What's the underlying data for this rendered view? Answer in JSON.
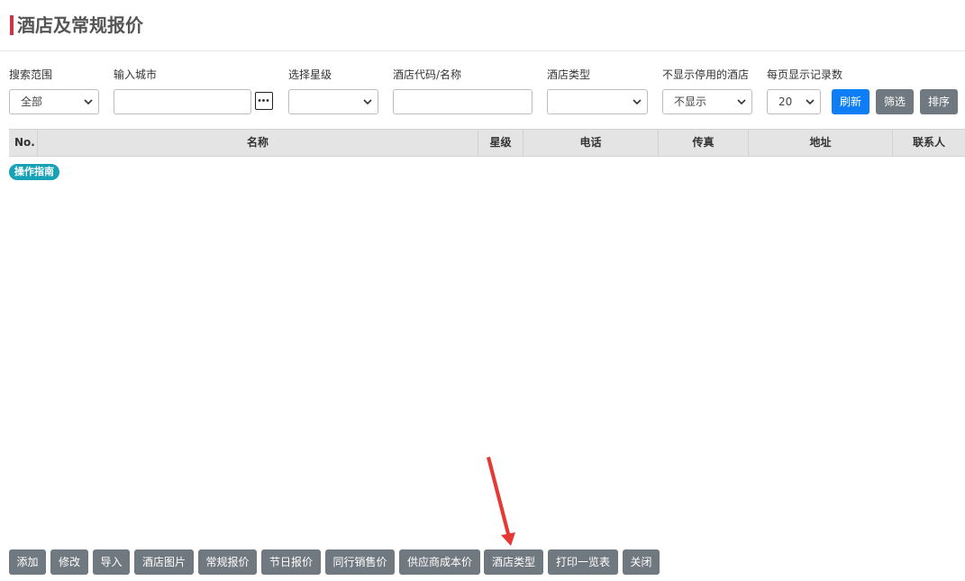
{
  "page": {
    "title": "酒店及常规报价",
    "accent_color": "#d9323f"
  },
  "filters": {
    "scope": {
      "label": "搜索范围",
      "value": "全部"
    },
    "city": {
      "label": "输入城市",
      "value": ""
    },
    "star": {
      "label": "选择星级",
      "value": ""
    },
    "code_name": {
      "label": "酒店代码/名称",
      "value": ""
    },
    "hotel_type": {
      "label": "酒店类型",
      "value": ""
    },
    "hide_disabled": {
      "label": "不显示停用的酒店",
      "value": "不显示"
    },
    "page_size": {
      "label": "每页显示记录数",
      "value": "20"
    }
  },
  "toolbar": {
    "refresh_label": "刷新",
    "filter_label": "筛选",
    "sort_label": "排序",
    "primary_color": "#0d7ef5",
    "secondary_color": "#717980"
  },
  "table": {
    "columns": [
      "No.",
      "名称",
      "星级",
      "电话",
      "传真",
      "地址",
      "联系人"
    ]
  },
  "guide_badge": {
    "label": "操作指南",
    "color": "#17a2b8"
  },
  "actions": [
    "添加",
    "修改",
    "导入",
    "酒店图片",
    "常规报价",
    "节日报价",
    "同行销售价",
    "供应商成本价",
    "酒店类型",
    "打印一览表",
    "关闭"
  ],
  "annotation": {
    "color": "#e53935",
    "target": "酒店类型"
  }
}
